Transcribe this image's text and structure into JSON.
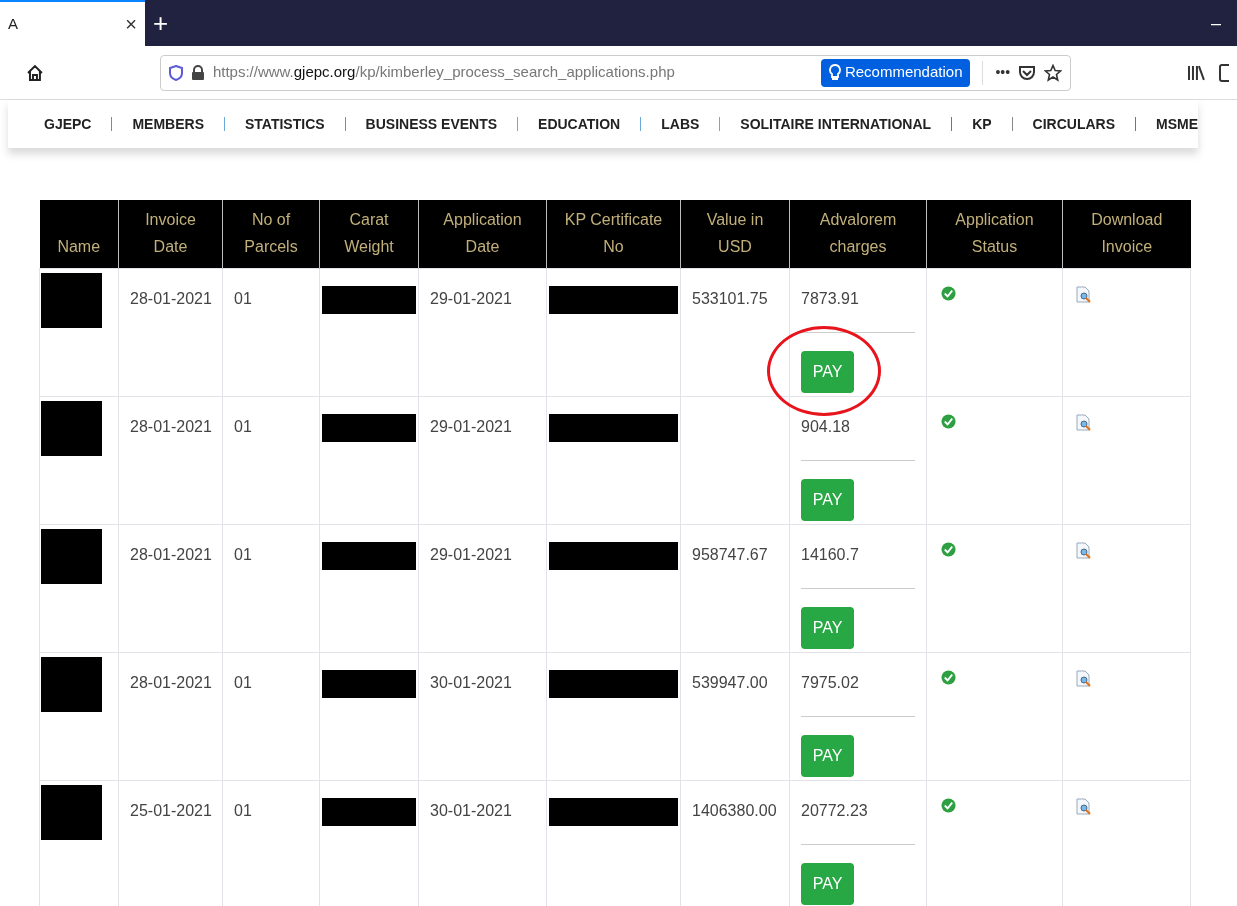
{
  "browser": {
    "tab_title": "A",
    "tab_close": "×",
    "new_tab": "+",
    "minimize": "–",
    "url": {
      "prefix": "https://www.",
      "domain": "gjepc.org",
      "path": "/kp/kimberley_process_search_applications.php"
    },
    "recommendation": "Recommendation",
    "more": "•••"
  },
  "nav": [
    "GJEPC",
    "MEMBERS",
    "STATISTICS",
    "BUSINESS EVENTS",
    "EDUCATION",
    "LABS",
    "SOLITAIRE INTERNATIONAL",
    "KP",
    "CIRCULARS",
    "MSME"
  ],
  "table": {
    "columns": [
      {
        "kind": "redacted",
        "label": "Name"
      },
      {
        "kind": "text",
        "label": "Invoice Date"
      },
      {
        "kind": "text",
        "label": "No of Parcels"
      },
      {
        "kind": "redacted",
        "label": "Carat Weight"
      },
      {
        "kind": "text",
        "label": "Application Date"
      },
      {
        "kind": "redacted",
        "label": "KP Certificate No"
      },
      {
        "kind": "text",
        "label": "Value in USD"
      },
      {
        "kind": "charges",
        "label": "Advalorem charges"
      },
      {
        "kind": "status",
        "label": "Application Status"
      },
      {
        "kind": "download",
        "label": "Download Invoice"
      }
    ],
    "rows": [
      {
        "invoice_date": "28-01-2021",
        "parcels": "01",
        "application_date": "29-01-2021",
        "value_usd": "533101.75",
        "advalorem": "7873.91",
        "pay": "PAY",
        "approved": true,
        "circled": true
      },
      {
        "invoice_date": "28-01-2021",
        "parcels": "01",
        "application_date": "29-01-2021",
        "advalorem": "904.18",
        "pay": "PAY",
        "approved": true,
        "circled": false
      },
      {
        "invoice_date": "28-01-2021",
        "parcels": "01",
        "application_date": "29-01-2021",
        "value_usd": "958747.67",
        "advalorem": "14160.7",
        "pay": "PAY",
        "approved": true,
        "circled": false
      },
      {
        "invoice_date": "28-01-2021",
        "parcels": "01",
        "application_date": "30-01-2021",
        "value_usd": "539947.00",
        "advalorem": "7975.02",
        "pay": "PAY",
        "approved": true,
        "circled": false
      },
      {
        "invoice_date": "25-01-2021",
        "parcels": "01",
        "application_date": "30-01-2021",
        "value_usd": "1406380.00",
        "advalorem": "20772.23",
        "pay": "PAY",
        "approved": true,
        "circled": false
      }
    ]
  }
}
